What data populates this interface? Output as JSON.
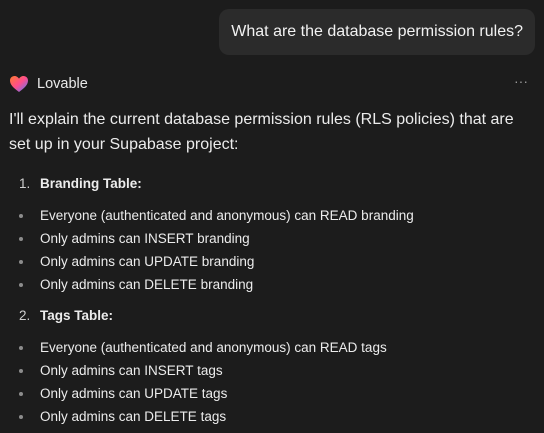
{
  "user_message": "What are the database permission rules?",
  "assistant": {
    "name": "Lovable",
    "logo_icon": "lovable-heart-icon",
    "more_icon": "ellipsis-icon",
    "intro": "I'll explain the current database permission rules (RLS policies) that are set up in your Supabase project:"
  },
  "sections": [
    {
      "number": "1.",
      "title": "Branding Table:",
      "bullets": [
        "Everyone (authenticated and anonymous) can READ branding",
        "Only admins can INSERT branding",
        "Only admins can UPDATE branding",
        "Only admins can DELETE branding"
      ]
    },
    {
      "number": "2.",
      "title": "Tags Table:",
      "bullets": [
        "Everyone (authenticated and anonymous) can READ tags",
        "Only admins can INSERT tags",
        "Only admins can UPDATE tags",
        "Only admins can DELETE tags"
      ]
    }
  ],
  "colors": {
    "background": "#1c1c1c",
    "bubble": "#2b2b2b",
    "text": "#ececec",
    "bullet": "#8c8c8c"
  }
}
